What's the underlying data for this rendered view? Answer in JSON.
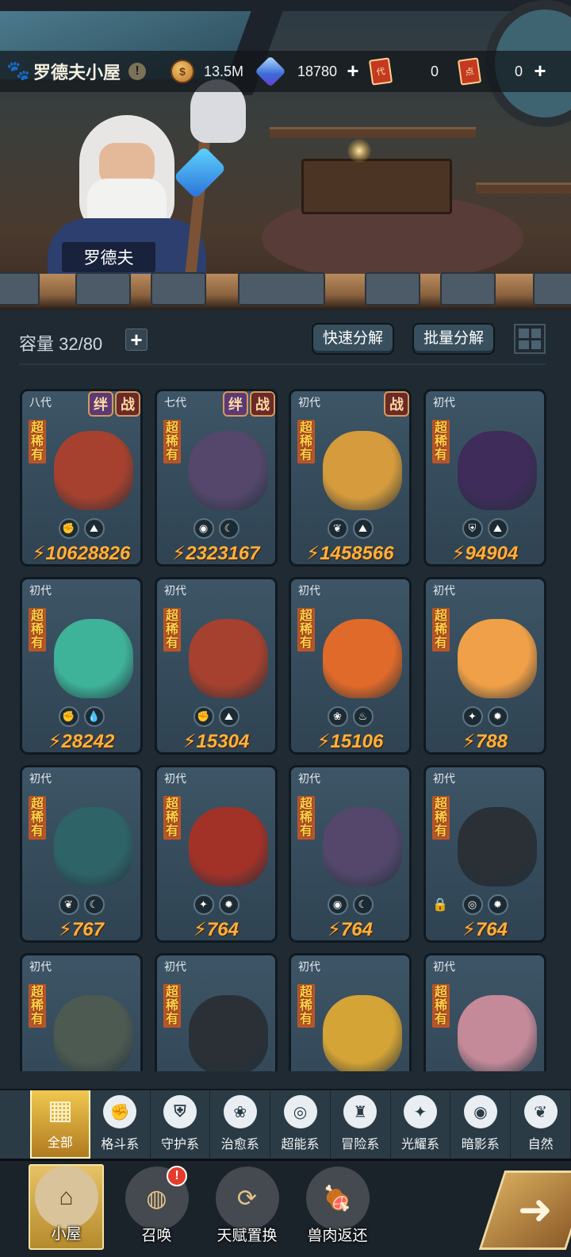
{
  "header": {
    "home_title": "罗德夫小屋",
    "npc_name": "罗德夫",
    "resources": [
      {
        "icon": "coin-icon",
        "value": "13.5M",
        "has_plus": false
      },
      {
        "icon": "gem-icon",
        "value": "18780",
        "has_plus": true
      },
      {
        "icon": "ticket-icon",
        "icon_text": "代",
        "value": "0",
        "has_plus": false
      },
      {
        "icon": "ticket-icon",
        "icon_text": "点",
        "value": "0",
        "has_plus": true
      }
    ]
  },
  "panel": {
    "capacity_label": "容量 32/80",
    "quick_decompose": "快速分解",
    "batch_decompose": "批量分解"
  },
  "tag_labels": {
    "bond": "绊",
    "battle": "战"
  },
  "rarity_label": "超稀有",
  "cards": [
    {
      "gen": "八代",
      "bond": true,
      "battle": true,
      "elements": [
        "fist",
        "earth"
      ],
      "power": "10628826",
      "color": "#a5412e"
    },
    {
      "gen": "七代",
      "bond": true,
      "battle": true,
      "elements": [
        "shadow",
        "moon"
      ],
      "power": "2323167",
      "color": "#54476b"
    },
    {
      "gen": "初代",
      "bond": false,
      "battle": true,
      "elements": [
        "leaf",
        "earth"
      ],
      "power": "1458566",
      "color": "#d59b3c"
    },
    {
      "gen": "初代",
      "bond": false,
      "battle": false,
      "elements": [
        "shield",
        "earth"
      ],
      "power": "94904",
      "color": "#3f2c5a"
    },
    {
      "gen": "初代",
      "bond": false,
      "battle": false,
      "elements": [
        "fist",
        "water"
      ],
      "power": "28242",
      "color": "#3fb29a"
    },
    {
      "gen": "初代",
      "bond": false,
      "battle": false,
      "elements": [
        "fist",
        "earth"
      ],
      "power": "15304",
      "color": "#a5412e"
    },
    {
      "gen": "初代",
      "bond": false,
      "battle": false,
      "elements": [
        "sprout",
        "fire"
      ],
      "power": "15106",
      "color": "#e06a2a"
    },
    {
      "gen": "初代",
      "bond": false,
      "battle": false,
      "elements": [
        "star",
        "sun"
      ],
      "power": "788",
      "color": "#f0a048"
    },
    {
      "gen": "初代",
      "bond": false,
      "battle": false,
      "elements": [
        "leaf",
        "moon"
      ],
      "power": "767",
      "color": "#2e6468"
    },
    {
      "gen": "初代",
      "bond": false,
      "battle": false,
      "elements": [
        "star",
        "sun"
      ],
      "power": "764",
      "color": "#a23228"
    },
    {
      "gen": "初代",
      "bond": false,
      "battle": false,
      "elements": [
        "shadow",
        "moon"
      ],
      "power": "764",
      "color": "#54476b"
    },
    {
      "gen": "初代",
      "bond": false,
      "battle": false,
      "elements": [
        "psychic",
        "sun"
      ],
      "power": "764",
      "color": "#2a3036",
      "locked": true
    },
    {
      "gen": "初代",
      "bond": false,
      "battle": false,
      "elements": [],
      "power": "",
      "color": "#4d5a52"
    },
    {
      "gen": "初代",
      "bond": false,
      "battle": false,
      "elements": [],
      "power": "",
      "color": "#2a3036"
    },
    {
      "gen": "初代",
      "bond": false,
      "battle": false,
      "elements": [],
      "power": "",
      "color": "#d5a436"
    },
    {
      "gen": "初代",
      "bond": false,
      "battle": false,
      "elements": [],
      "power": "",
      "color": "#c48a9a"
    }
  ],
  "categories": [
    {
      "label": "全部",
      "icon": "all-blocks-icon",
      "active": true
    },
    {
      "label": "格斗系",
      "icon": "fist-icon"
    },
    {
      "label": "守护系",
      "icon": "shield-icon"
    },
    {
      "label": "治愈系",
      "icon": "sprout-icon"
    },
    {
      "label": "超能系",
      "icon": "psychic-icon"
    },
    {
      "label": "冒险系",
      "icon": "lantern-icon"
    },
    {
      "label": "光耀系",
      "icon": "star-icon"
    },
    {
      "label": "暗影系",
      "icon": "shadow-eye-icon"
    },
    {
      "label": "自然",
      "icon": "leaf-icon"
    }
  ],
  "nav": [
    {
      "label": "小屋",
      "icon": "house-icon",
      "active": true
    },
    {
      "label": "召唤",
      "icon": "egg-icon",
      "badge": "!"
    },
    {
      "label": "天赋置换",
      "icon": "swap-icon"
    },
    {
      "label": "兽肉返还",
      "icon": "meat-icon"
    }
  ]
}
